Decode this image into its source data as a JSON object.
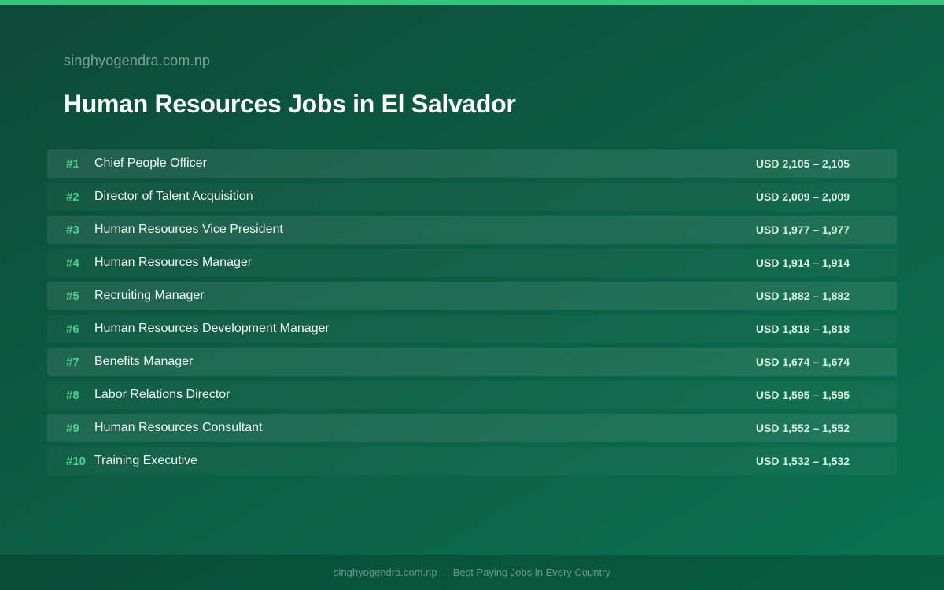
{
  "site": "singhyogendra.com.np",
  "title": "Human Resources Jobs in El Salvador",
  "jobs": [
    {
      "rank": "#1",
      "title": "Chief People Officer",
      "salary": "USD 2,105 – 2,105"
    },
    {
      "rank": "#2",
      "title": "Director of Talent Acquisition",
      "salary": "USD 2,009 – 2,009"
    },
    {
      "rank": "#3",
      "title": "Human Resources Vice President",
      "salary": "USD 1,977 – 1,977"
    },
    {
      "rank": "#4",
      "title": "Human Resources Manager",
      "salary": "USD 1,914 – 1,914"
    },
    {
      "rank": "#5",
      "title": "Recruiting Manager",
      "salary": "USD 1,882 – 1,882"
    },
    {
      "rank": "#6",
      "title": "Human Resources Development Manager",
      "salary": "USD 1,818 – 1,818"
    },
    {
      "rank": "#7",
      "title": "Benefits Manager",
      "salary": "USD 1,674 – 1,674"
    },
    {
      "rank": "#8",
      "title": "Labor Relations Director",
      "salary": "USD 1,595 – 1,595"
    },
    {
      "rank": "#9",
      "title": "Human Resources Consultant",
      "salary": "USD 1,552 – 1,552"
    },
    {
      "rank": "#10",
      "title": "Training Executive",
      "salary": "USD 1,532 – 1,532"
    }
  ],
  "footer": "singhyogendra.com.np — Best Paying Jobs in Every Country",
  "colors": {
    "accent": "#34c47e",
    "rank": "#4fd08e",
    "background": "#0c5c42"
  }
}
